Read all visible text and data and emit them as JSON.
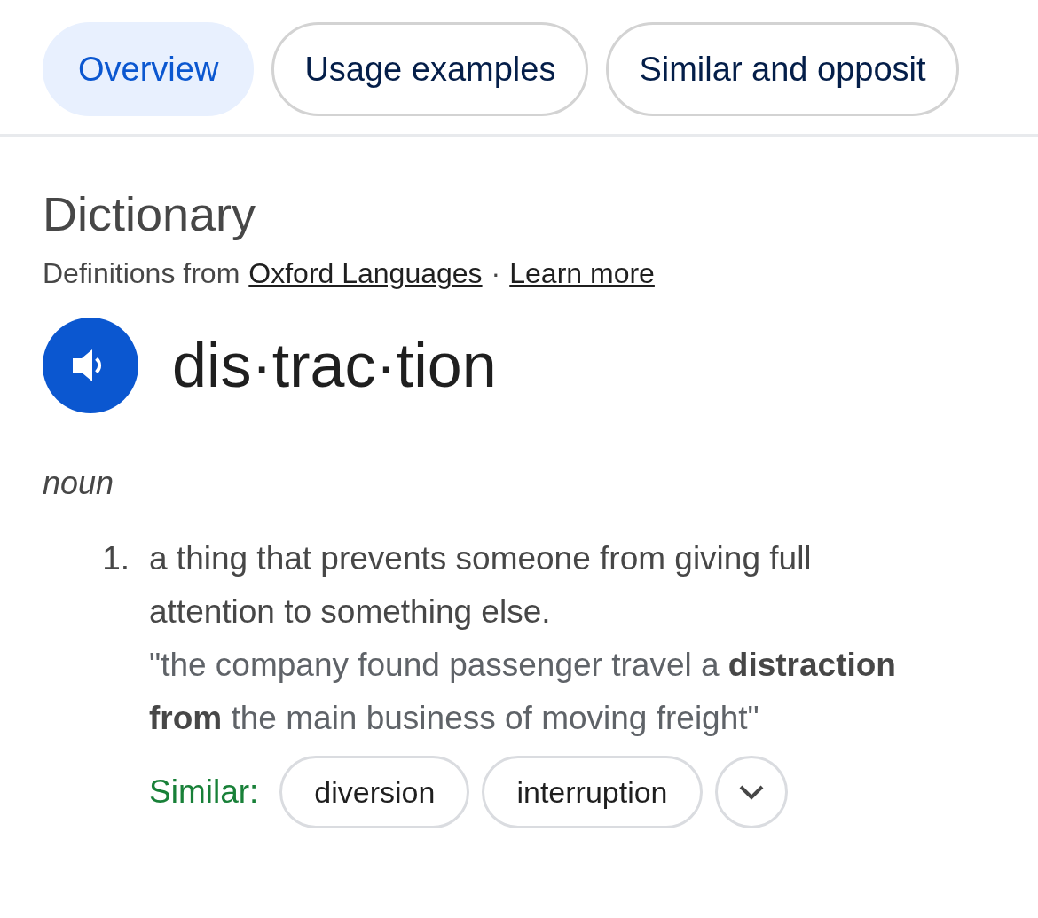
{
  "tabs": [
    {
      "label": "Overview",
      "selected": true
    },
    {
      "label": "Usage examples",
      "selected": false
    },
    {
      "label": "Similar and opposit",
      "selected": false
    }
  ],
  "dictionary": {
    "title": "Dictionary",
    "source_prefix": "Definitions from",
    "source_link": "Oxford Languages",
    "separator": "·",
    "learn_more": "Learn more"
  },
  "entry": {
    "word": "dis·trac·tion",
    "part_of_speech": "noun",
    "senses": [
      {
        "number": "1.",
        "definition": "a thing that prevents someone from giving full attention to something else.",
        "example": "\"the company found passenger travel a **distraction from** the main business of moving freight\"",
        "similar_label": "Similar:",
        "similar": [
          "diversion",
          "interruption"
        ]
      }
    ]
  }
}
